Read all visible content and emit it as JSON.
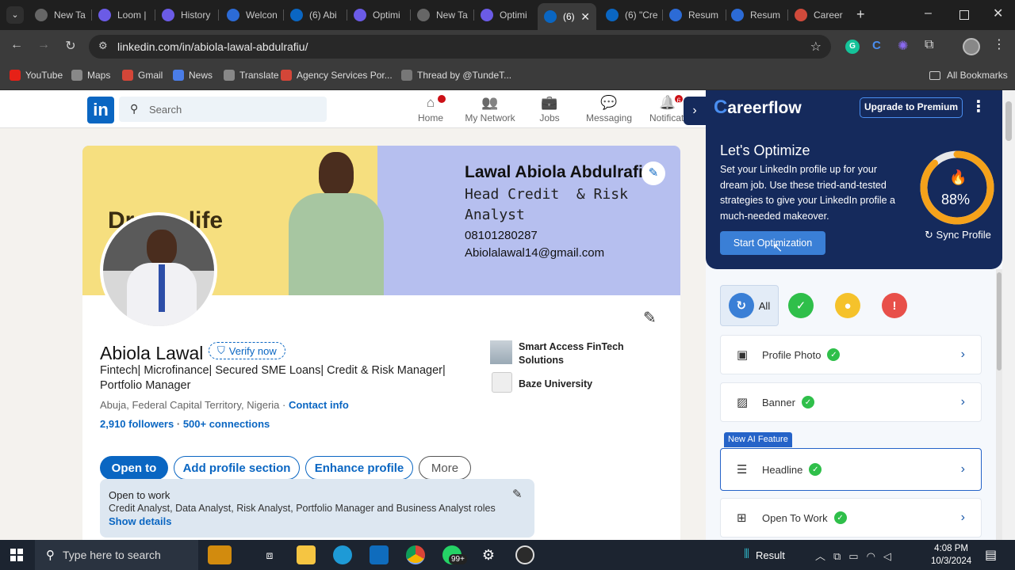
{
  "browser": {
    "tabs": [
      {
        "label": "New Ta",
        "fav_color": "#666"
      },
      {
        "label": "Loom |",
        "fav_color": "#6b5be6"
      },
      {
        "label": "History",
        "fav_color": "#6b5be6"
      },
      {
        "label": "Welcon",
        "fav_color": "#2c6bd6"
      },
      {
        "label": "(6) Abi",
        "fav_color": "#0a66c2"
      },
      {
        "label": "Optimi",
        "fav_color": "#6b5be6"
      },
      {
        "label": "New Ta",
        "fav_color": "#666"
      },
      {
        "label": "Optimi",
        "fav_color": "#6b5be6"
      },
      {
        "label": "(6)",
        "fav_color": "#0a66c2"
      },
      {
        "label": "(6) \"Cre",
        "fav_color": "#0a66c2"
      },
      {
        "label": "Resum",
        "fav_color": "#2c6bd6"
      },
      {
        "label": "Resum",
        "fav_color": "#2c6bd6"
      },
      {
        "label": "Career",
        "fav_color": "#d04a3b"
      }
    ],
    "url": "linkedin.com/in/abiola-lawal-abdulrafiu/",
    "bookmarks": [
      {
        "label": "YouTube",
        "color": "#e62117"
      },
      {
        "label": "Maps",
        "color": "#888"
      },
      {
        "label": "Gmail",
        "color": "#d44638"
      },
      {
        "label": "News",
        "color": "#4a7de8"
      },
      {
        "label": "Translate",
        "color": "#888"
      },
      {
        "label": "Agency Services Por...",
        "color": "#d44638"
      },
      {
        "label": "Thread by @TundeT...",
        "color": "#777"
      }
    ],
    "all_bookmarks": "All Bookmarks"
  },
  "linkedin": {
    "logo": "in",
    "search_placeholder": "Search",
    "nav": [
      {
        "label": "Home",
        "icon": "home-icon"
      },
      {
        "label": "My Network",
        "icon": "network-icon"
      },
      {
        "label": "Jobs",
        "icon": "jobs-icon"
      },
      {
        "label": "Messaging",
        "icon": "messaging-icon"
      },
      {
        "label": "Notificati",
        "icon": "bell-icon",
        "badge": "6"
      }
    ],
    "banner": {
      "left_text": "Dream life",
      "name": "Lawal Abiola Abdulrafiu",
      "title_line1": "Head Credit  & Risk",
      "title_line2": "Analyst",
      "phone": "08101280287",
      "email": "Abiolalawal14@gmail.com"
    },
    "profile": {
      "name": "Abiola Lawal",
      "verify": "Verify now",
      "headline": "Fintech| Microfinance| Secured SME Loans| Credit & Risk Manager| Portfolio Manager",
      "location": "Abuja, Federal Capital Territory, Nigeria",
      "contact": "Contact info",
      "followers": "2,910 followers",
      "connections": "500+ connections",
      "sep": "·",
      "company": "Smart Access FinTech Solutions",
      "school": "Baze University"
    },
    "buttons": {
      "open_to": "Open to",
      "add_section": "Add profile section",
      "enhance": "Enhance profile",
      "more": "More"
    },
    "open_to_work": {
      "title": "Open to work",
      "roles": "Credit Analyst, Data Analyst, Risk Analyst, Portfolio Manager and Business Analyst roles",
      "link": "Show details"
    }
  },
  "careerflow": {
    "brand": "areerflow",
    "brand_c": "C",
    "upgrade": "Upgrade to Premium",
    "heading": "Let's Optimize",
    "desc": "Set your LinkedIn profile up for your dream job. Use these tried-and-tested strategies to give your LinkedIn profile a much-needed makeover.",
    "start": "Start Optimization",
    "score_label": "88%",
    "score": 0.88,
    "sync": "Sync Profile",
    "filter_all": "All",
    "new_feature": "New AI Feature",
    "items": [
      {
        "label": "Profile Photo",
        "icon": "profile-photo-icon"
      },
      {
        "label": "Banner",
        "icon": "banner-icon"
      },
      {
        "label": "Headline",
        "icon": "headline-icon"
      },
      {
        "label": "Open To Work",
        "icon": "open-to-work-icon"
      }
    ]
  },
  "taskbar": {
    "search": "Type here to search",
    "badge": "99+",
    "result": "Result",
    "time": "4:08 PM",
    "date": "10/3/2024"
  }
}
